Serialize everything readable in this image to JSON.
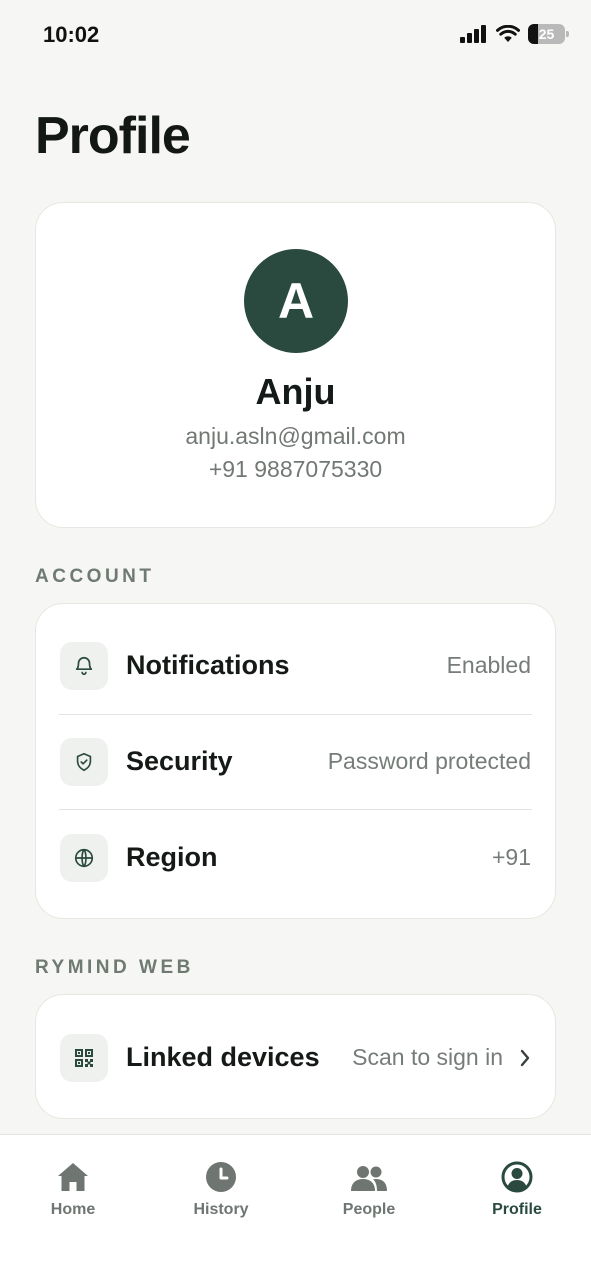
{
  "status_bar": {
    "time": "10:02",
    "battery": "25"
  },
  "page": {
    "title": "Profile"
  },
  "profile": {
    "avatar_initial": "A",
    "name": "Anju",
    "email": "anju.asln@gmail.com",
    "phone": "+91 9887075330"
  },
  "sections": {
    "account_label": "ACCOUNT",
    "web_label": "RYMIND WEB"
  },
  "account_rows": [
    {
      "label": "Notifications",
      "value": "Enabled",
      "icon": "bell-icon"
    },
    {
      "label": "Security",
      "value": "Password protected",
      "icon": "shield-check-icon"
    },
    {
      "label": "Region",
      "value": "+91",
      "icon": "globe-icon"
    }
  ],
  "web_rows": [
    {
      "label": "Linked devices",
      "value": "Scan to sign in",
      "icon": "qr-code-icon"
    }
  ],
  "tab_bar": {
    "tabs": [
      {
        "label": "Home",
        "icon": "home-icon"
      },
      {
        "label": "History",
        "icon": "clock-icon"
      },
      {
        "label": "People",
        "icon": "people-icon"
      },
      {
        "label": "Profile",
        "icon": "user-circle-icon",
        "active": true
      }
    ]
  },
  "colors": {
    "accent": "#2a4a3f",
    "background": "#f6f6f4",
    "muted_text": "#767c78",
    "section_label": "#6e7a72"
  }
}
